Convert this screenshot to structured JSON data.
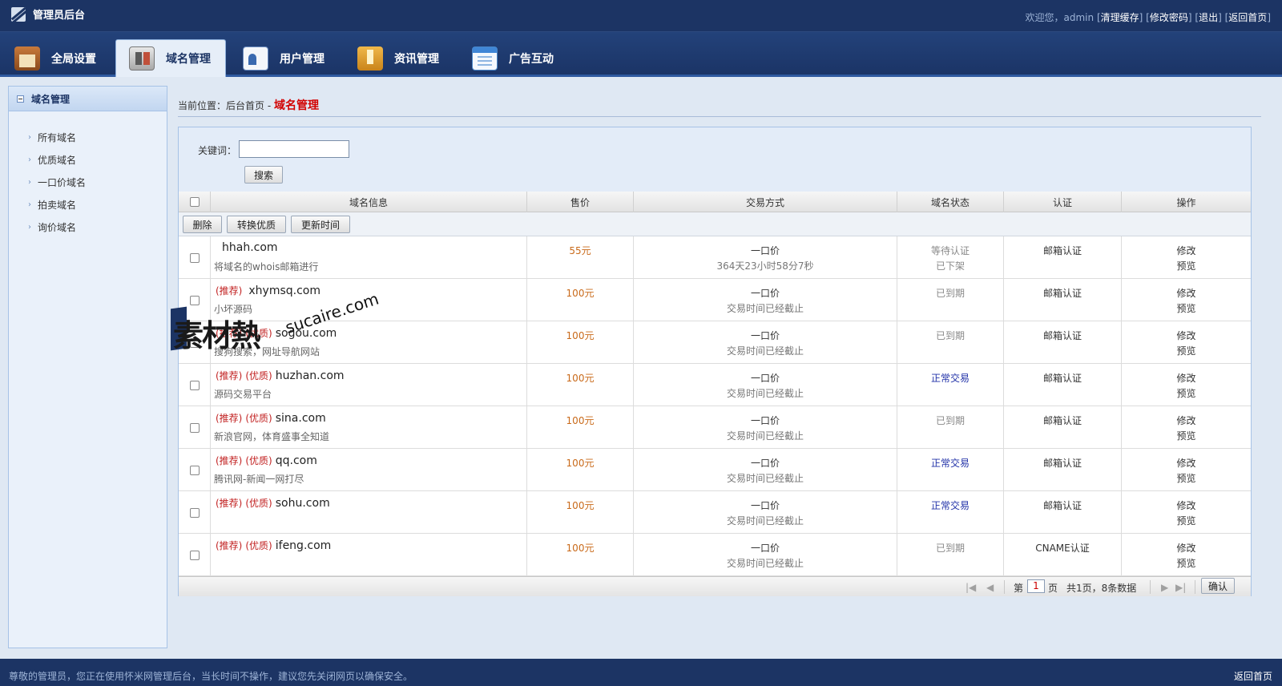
{
  "app": {
    "title": "管理员后台"
  },
  "toplinks": {
    "welcome": "欢迎您，admin",
    "clear_cache": "清理缓存",
    "change_pwd": "修改密码",
    "logout": "退出",
    "home": "返回首页"
  },
  "nav": {
    "tabs": [
      "全局设置",
      "域名管理",
      "用户管理",
      "资讯管理",
      "广告互动"
    ],
    "active": "域名管理"
  },
  "sidebar": {
    "title": "域名管理",
    "items": [
      "所有域名",
      "优质域名",
      "一口价域名",
      "拍卖域名",
      "询价域名"
    ]
  },
  "breadcrumb": {
    "prefix": "当前位置：",
    "home": "后台首页",
    "sep": " - ",
    "current": "域名管理"
  },
  "search": {
    "label": "关键词：",
    "value": "",
    "button": "搜索"
  },
  "table": {
    "headers": [
      "域名信息",
      "售价",
      "交易方式",
      "域名状态",
      "认证",
      "操作"
    ],
    "actions": [
      "删除",
      "转换优质",
      "更新时间"
    ],
    "rows": [
      {
        "tags": [
          "",
          ""
        ],
        "domain": "hhah.com",
        "desc": "将域名的whois邮箱进行",
        "price": "55元",
        "mode": "一口价",
        "time": "364天23小时58分7秒",
        "status": "等待认证",
        "status2": "已下架",
        "status_color": "#888888",
        "auth": "邮箱认证",
        "op1": "修改",
        "op2": "预览"
      },
      {
        "tags": [
          "(推荐)",
          ""
        ],
        "domain": "xhymsq.com",
        "desc": "小坏源码",
        "price": "100元",
        "mode": "一口价",
        "time": "交易时间已经截止",
        "status": "已到期",
        "status2": "",
        "status_color": "#888888",
        "auth": "邮箱认证",
        "op1": "修改",
        "op2": "预览"
      },
      {
        "tags": [
          "(推荐)",
          "(优质)"
        ],
        "domain": "sogou.com",
        "desc": "搜狗搜索，网址导航网站",
        "price": "100元",
        "mode": "一口价",
        "time": "交易时间已经截止",
        "status": "已到期",
        "status2": "",
        "status_color": "#888888",
        "auth": "邮箱认证",
        "op1": "修改",
        "op2": "预览"
      },
      {
        "tags": [
          "(推荐)",
          "(优质)"
        ],
        "domain": "huzhan.com",
        "desc": "源码交易平台",
        "price": "100元",
        "mode": "一口价",
        "time": "交易时间已经截止",
        "status": "正常交易",
        "status2": "",
        "status_color": "#2232a8",
        "auth": "邮箱认证",
        "op1": "修改",
        "op2": "预览"
      },
      {
        "tags": [
          "(推荐)",
          "(优质)"
        ],
        "domain": "sina.com",
        "desc": "新浪官网，体育盛事全知道",
        "price": "100元",
        "mode": "一口价",
        "time": "交易时间已经截止",
        "status": "已到期",
        "status2": "",
        "status_color": "#888888",
        "auth": "邮箱认证",
        "op1": "修改",
        "op2": "预览"
      },
      {
        "tags": [
          "(推荐)",
          "(优质)"
        ],
        "domain": "qq.com",
        "desc": "腾讯网-新闻一网打尽",
        "price": "100元",
        "mode": "一口价",
        "time": "交易时间已经截止",
        "status": "正常交易",
        "status2": "",
        "status_color": "#2232a8",
        "auth": "邮箱认证",
        "op1": "修改",
        "op2": "预览"
      },
      {
        "tags": [
          "(推荐)",
          "(优质)"
        ],
        "domain": "sohu.com",
        "desc": "",
        "price": "100元",
        "mode": "一口价",
        "time": "交易时间已经截止",
        "status": "正常交易",
        "status2": "",
        "status_color": "#2232a8",
        "auth": "邮箱认证",
        "op1": "修改",
        "op2": "预览"
      },
      {
        "tags": [
          "(推荐)",
          "(优质)"
        ],
        "domain": "ifeng.com",
        "desc": "",
        "price": "100元",
        "mode": "一口价",
        "time": "交易时间已经截止",
        "status": "已到期",
        "status2": "",
        "status_color": "#888888",
        "auth": "CNAME认证",
        "op1": "修改",
        "op2": "预览"
      }
    ]
  },
  "pager": {
    "page_prefix": "第",
    "page_value": "1",
    "page_suffix": "页",
    "summary": "共1页，8条数据",
    "confirm": "确认"
  },
  "watermark": {
    "cn": "素材熱",
    "en": "sucaire.com"
  },
  "footer": {
    "notice": "尊敬的管理员，您正在使用怀米网管理后台，当长时间不操作，建议您先关闭网页以确保安全。",
    "home": "返回首页"
  }
}
